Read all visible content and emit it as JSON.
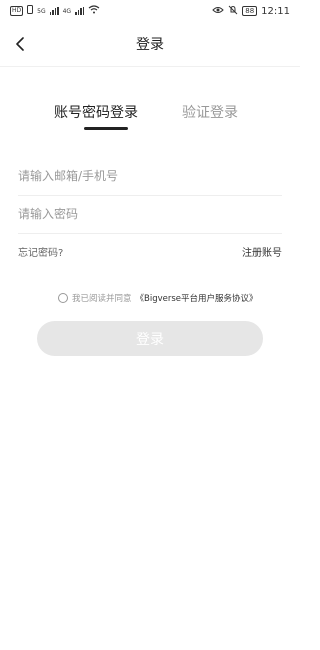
{
  "status_bar": {
    "left_badge": "HD",
    "signal_1": "5G",
    "signal_2": "4G",
    "time": "12:11",
    "battery": "88",
    "icons": [
      "hd-icon",
      "sim-icon",
      "signal-icon",
      "wifi-icon",
      "eye-icon",
      "mute-icon",
      "battery-icon"
    ]
  },
  "nav": {
    "title": "登录",
    "back_icon": "chevron-left-icon"
  },
  "tabs": [
    {
      "label": "账号密码登录",
      "active": true
    },
    {
      "label": "验证登录",
      "active": false
    }
  ],
  "form": {
    "email_placeholder": "请输入邮箱/手机号",
    "email_value": "",
    "password_placeholder": "请输入密码",
    "password_value": ""
  },
  "links": {
    "forgot": "忘记密码?",
    "register": "注册账号"
  },
  "agreement": {
    "prefix": "我已阅读并同意",
    "link": "《Bigverse平台用户服务协议》"
  },
  "submit_label": "登录",
  "colors": {
    "button_bg": "#e6e6e6",
    "primary_text": "#222222",
    "muted_text": "#999999"
  }
}
